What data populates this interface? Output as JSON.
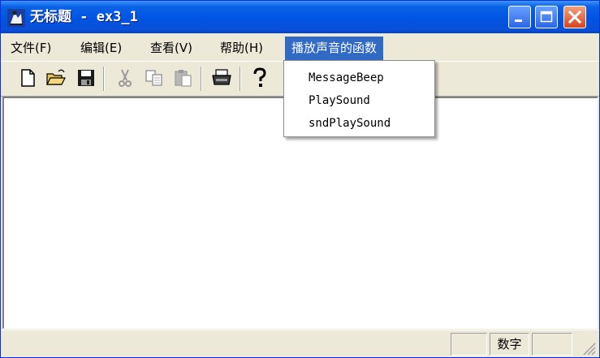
{
  "window": {
    "title": "无标题 - ex3_1"
  },
  "menubar": {
    "items": [
      {
        "label": "文件(F)"
      },
      {
        "label": "编辑(E)"
      },
      {
        "label": "查看(V)"
      },
      {
        "label": "帮助(H)"
      },
      {
        "label": "播放声音的函数"
      }
    ]
  },
  "dropdown": {
    "items": [
      {
        "label": "MessageBeep"
      },
      {
        "label": "PlaySound"
      },
      {
        "label": "sndPlaySound"
      }
    ]
  },
  "toolbar": {
    "buttons": [
      "new-file-icon",
      "open-folder-icon",
      "save-icon",
      "cut-icon",
      "copy-icon",
      "paste-icon",
      "print-icon",
      "help-icon"
    ]
  },
  "statusbar": {
    "indicator": "数字"
  },
  "colors": {
    "titlebar": "#0054e3",
    "menu_highlight": "#316ac5",
    "face": "#ece9d8",
    "close": "#d4451f"
  }
}
